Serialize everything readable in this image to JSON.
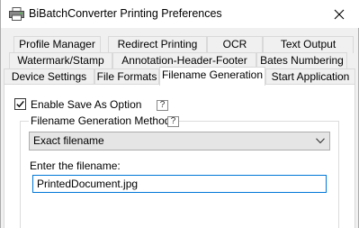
{
  "window": {
    "title": "BiBatchConverter Printing Preferences",
    "icon": "printer-icon",
    "close_icon": "close-icon"
  },
  "tabs": {
    "row1": [
      "Profile Manager",
      "Redirect Printing",
      "OCR",
      "Text Output"
    ],
    "row2": [
      "Watermark/Stamp",
      "Annotation-Header-Footer",
      "Bates Numbering"
    ],
    "row3": [
      "Device Settings",
      "File Formats",
      "Filename Generation",
      "Start Application"
    ],
    "active": "Filename Generation"
  },
  "panel": {
    "enable_save_as": {
      "label": "Enable Save As Option",
      "checked": true,
      "help": "?"
    },
    "methods_group": {
      "title": "Filename Generation Methods",
      "help": "?",
      "selected_method": "Exact filename"
    },
    "filename_label": "Enter the filename:",
    "filename_value": "PrintedDocument.jpg"
  },
  "colors": {
    "accent": "#0078d7",
    "background": "#f0f0f0",
    "panel": "#ffffff"
  }
}
